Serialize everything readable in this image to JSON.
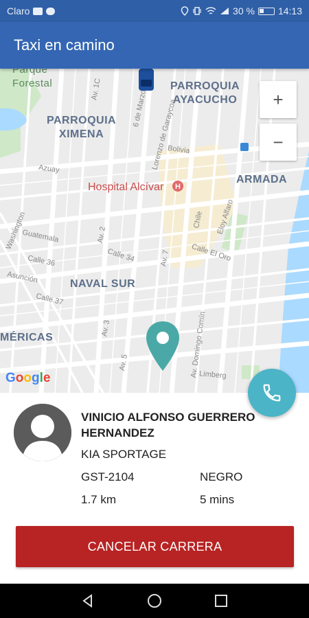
{
  "status_bar": {
    "carrier": "Claro",
    "battery": "30 %",
    "time": "14:13"
  },
  "app_bar": {
    "title": "Taxi en camino"
  },
  "map": {
    "zoom_in": "+",
    "zoom_out": "−",
    "areas": {
      "parque_forestal": "Parque\nForestal",
      "parroquia_ayacucho": "PARROQUIA\nAYACUCHO",
      "parroquia_ximena": "PARROQUIA\nXIMENA",
      "armada": "ARMADA",
      "naval_sur": "NAVAL SUR",
      "americas": "MÉRICAS"
    },
    "hospital": "Hospital Alcívar",
    "streets": {
      "av1c": "Av. 1C",
      "seis_marzo": "6 de Marzo",
      "lorenzo": "Lorenzo de Garaycoa",
      "bolivia": "Bolivia",
      "azuay": "Azuay",
      "chile": "Chile",
      "eloy": "Eloy Alfaro",
      "guatemala": "Guatemala",
      "washington": "Washington",
      "calle36": "Calle 36",
      "asuncion": "Asunción",
      "calle37": "Calle 37",
      "av2": "Av. 2",
      "calle34": "Calle 34",
      "av7": "Av. 7",
      "calle_oro": "Calle El Oro",
      "av3": "Av. 3",
      "av5": "Av. 5",
      "domingo": "Av. Domingo Comín",
      "limberg": "Limberg"
    },
    "google": [
      "G",
      "o",
      "o",
      "g",
      "l",
      "e"
    ]
  },
  "driver": {
    "name": "VINICIO ALFONSO  GUERRERO HERNANDEZ",
    "car_model": "KIA SPORTAGE",
    "plate": "GST-2104",
    "car_color": "NEGRO",
    "distance": "1.7 km",
    "eta": "5 mins"
  },
  "actions": {
    "cancel_label": "CANCELAR CARRERA"
  },
  "colors": {
    "app_bar": "#3466b3",
    "cancel_button": "#b82323",
    "call_fab": "#4bb4c7",
    "pin": "#4aa9a6"
  }
}
